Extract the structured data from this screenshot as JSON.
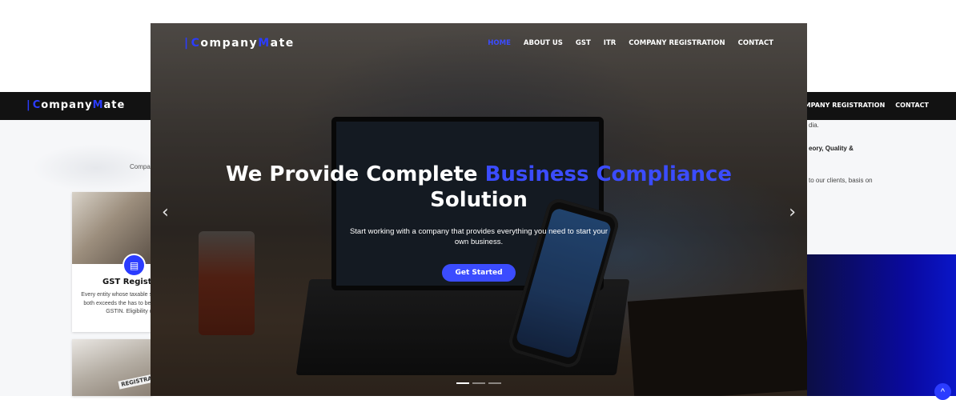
{
  "brand": {
    "prefix": "C",
    "mid": "ompany",
    "cap2": "M",
    "suffix": "ate"
  },
  "hero_nav": {
    "items": [
      "HOME",
      "ABOUT US",
      "GST",
      "ITR",
      "COMPANY REGISTRATION",
      "CONTACT"
    ],
    "active": "HOME"
  },
  "bg_nav": {
    "items": [
      "COMPANY REGISTRATION",
      "CONTACT"
    ]
  },
  "hero": {
    "title_part1": "We Provide Complete ",
    "title_highlight": "Business Compliance",
    "title_part2": "Solution",
    "subtitle": "Start working with a company that provides everything you need to start your own business.",
    "cta_label": "Get Started",
    "prev_symbol": "‹",
    "next_symbol": "›"
  },
  "background": {
    "company_snippet": "Compan",
    "card1": {
      "title": "GST Registrat",
      "description": "Every entity whose taxable sup Services or both exceeds the has to be registered for GSTIN. Eligibility criteri"
    },
    "card2": {
      "tag": "REGISTRA"
    },
    "right_text_1": "dia.",
    "right_text_2": "eory, Quality &",
    "right_text_3": "to our clients, basis on",
    "scroll_top_symbol": "^"
  },
  "colors": {
    "accent": "#3b4cff",
    "navbar": "#121212",
    "navy_panel": "#0a0aa2"
  }
}
